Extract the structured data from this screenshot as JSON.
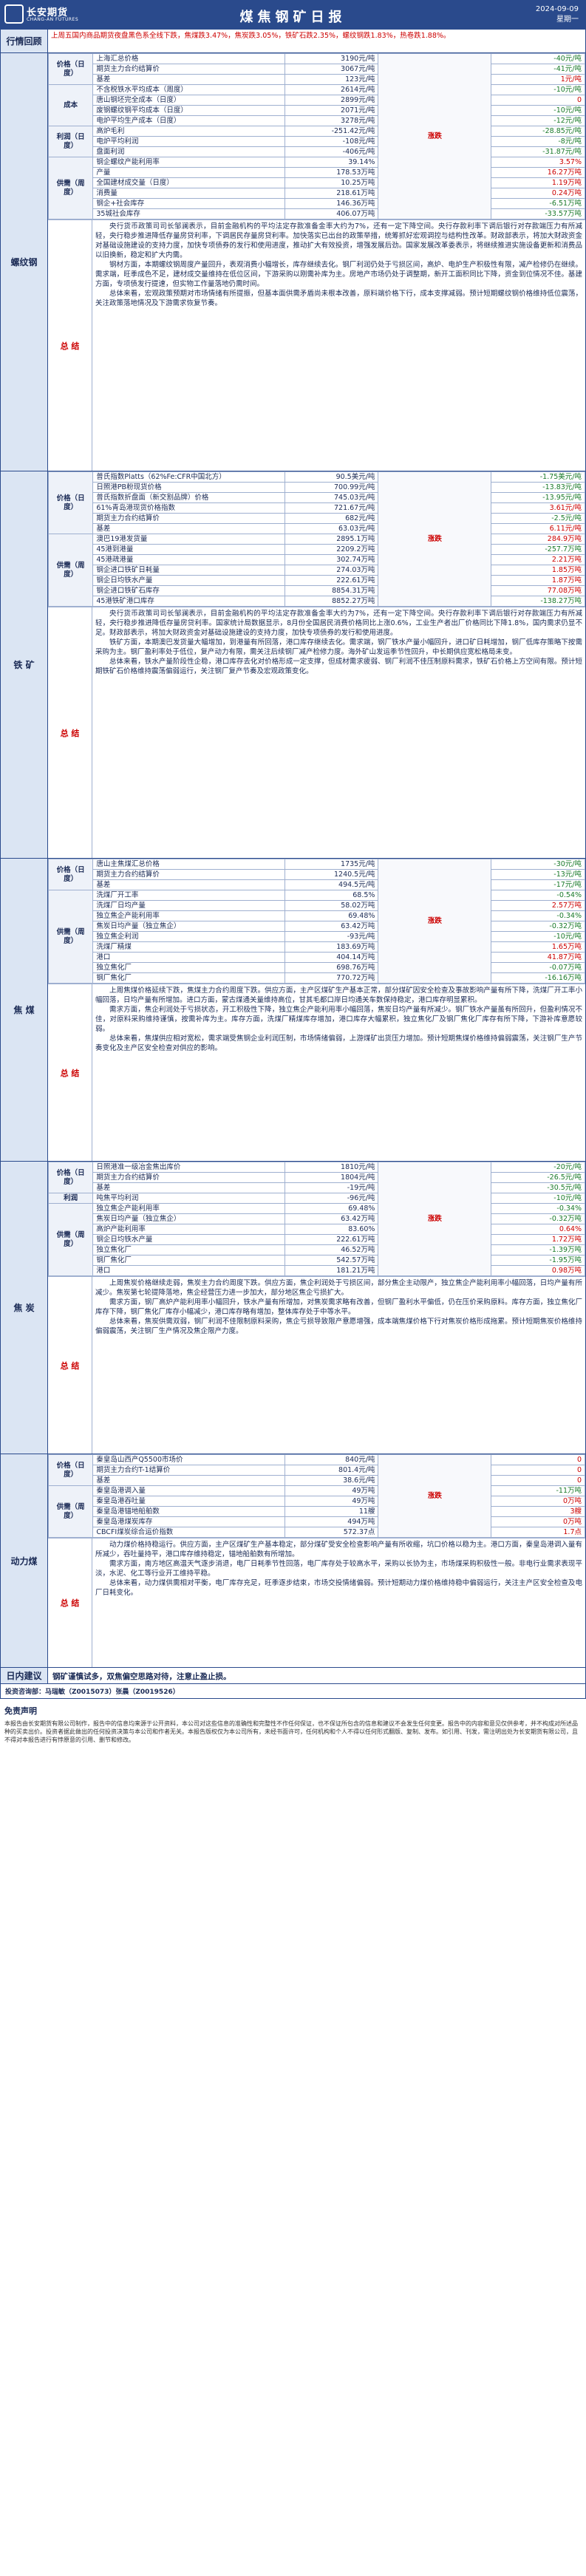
{
  "header": {
    "logo_cn": "长安期货",
    "logo_en": "CHANG-AN FUTURES",
    "title": "煤焦钢矿日报",
    "date": "2024-09-09",
    "weekday": "星期一"
  },
  "highlights": {
    "label": "行情回顾",
    "text": "上周五国内商品期货夜盘黑色系全线下跌，焦煤跌3.47%，焦炭跌3.05%，铁矿石跌2.35%，螺纹钢跌1.83%，热卷跌1.88%。"
  },
  "sections": [
    {
      "name": "螺纹钢",
      "groups": [
        {
          "cat": "价格（日度）",
          "rows": [
            {
              "item": "上海汇总价格",
              "value": "3190元/吨",
              "change": "-40元/吨",
              "dir": "neg"
            },
            {
              "item": "期货主力合约结算价",
              "value": "3067元/吨",
              "change": "-41元/吨",
              "dir": "neg"
            },
            {
              "item": "基差",
              "value": "123元/吨",
              "change": "1元/吨",
              "dir": "pos"
            }
          ]
        },
        {
          "cat": "成本",
          "rows": [
            {
              "item": "不含税铁水平均成本（周度）",
              "value": "2614元/吨",
              "change": "-10元/吨",
              "dir": "neg"
            },
            {
              "item": "唐山钢坯完全成本（日度）",
              "value": "2899元/吨",
              "change": "0",
              "dir": "pos"
            },
            {
              "item": "废钢螺纹钢平均成本（日度）",
              "value": "2071元/吨",
              "change": "-10元/吨",
              "dir": "neg"
            },
            {
              "item": "电炉平均生产成本（日度）",
              "value": "3278元/吨",
              "change": "-12元/吨",
              "dir": "neg"
            }
          ]
        },
        {
          "cat": "利润（日度）",
          "rows": [
            {
              "item": "高炉毛利",
              "value": "-251.42元/吨",
              "change": "-28.85元/吨",
              "dir": "neg"
            },
            {
              "item": "电炉平均利润",
              "value": "-108元/吨",
              "change": "-8元/吨",
              "dir": "neg"
            },
            {
              "item": "盘面利润",
              "value": "-406元/吨",
              "change": "-31.87元/吨",
              "dir": "neg"
            }
          ]
        },
        {
          "cat": "供需（周度）",
          "rows": [
            {
              "item": "钢企螺纹产能利用率",
              "value": "39.14%",
              "change": "3.57%",
              "dir": "pos"
            },
            {
              "item": "产量",
              "value": "178.53万吨",
              "change": "16.27万吨",
              "dir": "pos"
            },
            {
              "item": "全国建材成交量（日度）",
              "value": "10.25万吨",
              "change": "1.19万吨",
              "dir": "pos"
            },
            {
              "item": "消费量",
              "value": "218.61万吨",
              "change": "0.24万吨",
              "dir": "pos"
            },
            {
              "item": "钢企+社会库存",
              "value": "146.36万吨",
              "change": "-6.51万吨",
              "dir": "neg"
            },
            {
              "item": "35城社会库存",
              "value": "406.07万吨",
              "change": "-33.57万吨",
              "dir": "neg"
            }
          ]
        }
      ],
      "trend": "涨跌",
      "summary_label": "总 结",
      "summary": [
        "央行货币政策司司长邹澜表示，目前金融机构的平均法定存款准备金率大约为7%，还有一定下降空间。央行存款利率下调后银行对存款端压力有所减轻，央行稳步推进降低存量房贷利率，下调居民存量房贷利率。加快落实已出台的政策举措，统筹抓好宏观调控与结构性改革。财政部表示，将加大财政资金对基础设施建设的支持力度，加快专项债券的发行和使用进度，推动扩大有效投资，增强发展后劲。国家发展改革委表示，将继续推进实施设备更新和消费品以旧换新，稳定和扩大内需。",
        "钢材方面，本期螺纹钢周度产量回升，表观消费小幅增长，库存继续去化。钢厂利润仍处于亏损区间，高炉、电炉生产积极性有限，减产检修仍在继续。需求端，旺季成色不足，建材成交量维持在低位区间，下游采购以刚需补库为主。房地产市场仍处于调整期，新开工面积同比下降，资金到位情况不佳。基建方面，专项债发行提速，但实物工作量落地仍需时间。",
        "总体来看，宏观政策预期对市场情绪有所提振，但基本面供需矛盾尚未根本改善，原料端价格下行，成本支撑减弱。预计短期螺纹钢价格维持低位震荡，关注政策落地情况及下游需求恢复节奏。"
      ]
    },
    {
      "name": "铁 矿",
      "groups": [
        {
          "cat": "价格（日度）",
          "rows": [
            {
              "item": "普氏指数Platts（62%Fe:CFR中国北方）",
              "value": "90.5美元/吨",
              "change": "-1.75美元/吨",
              "dir": "neg"
            },
            {
              "item": "日照港PB粉现货价格",
              "value": "700.99元/吨",
              "change": "-13.83元/吨",
              "dir": "neg"
            },
            {
              "item": "普氏指数折盘面（新交割品牌）价格",
              "value": "745.03元/吨",
              "change": "-13.95元/吨",
              "dir": "neg"
            },
            {
              "item": "61%青岛港现货价格指数",
              "value": "721.67元/吨",
              "change": "3.61元/吨",
              "dir": "pos"
            },
            {
              "item": "期货主力合约结算价",
              "value": "682元/吨",
              "change": "-2.5元/吨",
              "dir": "neg"
            },
            {
              "item": "基差",
              "value": "63.03元/吨",
              "change": "6.11元/吨",
              "dir": "pos"
            }
          ]
        },
        {
          "cat": "供需（周度）",
          "rows": [
            {
              "item": "澳巴19港发货量",
              "value": "2895.1万吨",
              "change": "284.9万吨",
              "dir": "pos"
            },
            {
              "item": "45港到港量",
              "value": "2209.2万吨",
              "change": "-257.7万吨",
              "dir": "neg"
            },
            {
              "item": "45港疏港量",
              "value": "302.74万吨",
              "change": "2.21万吨",
              "dir": "pos"
            },
            {
              "item": "钢企进口铁矿日耗量",
              "value": "274.03万吨",
              "change": "1.85万吨",
              "dir": "pos"
            },
            {
              "item": "钢企日均铁水产量",
              "value": "222.61万吨",
              "change": "1.87万吨",
              "dir": "pos"
            },
            {
              "item": "钢企进口铁矿石库存",
              "value": "8854.31万吨",
              "change": "77.08万吨",
              "dir": "pos"
            },
            {
              "item": "45港铁矿港口库存",
              "value": "8852.27万吨",
              "change": "-138.27万吨",
              "dir": "neg"
            }
          ]
        }
      ],
      "trend": "涨跌",
      "summary_label": "总 结",
      "summary": [
        "央行货币政策司司长邹澜表示，目前金融机构的平均法定存款准备金率大约为7%，还有一定下降空间。央行存款利率下调后银行对存款端压力有所减轻，央行稳步推进降低存量房贷利率。国家统计局数据显示，8月份全国居民消费价格同比上涨0.6%，工业生产者出厂价格同比下降1.8%，国内需求仍显不足。财政部表示，将加大财政资金对基础设施建设的支持力度，加快专项债券的发行和使用进度。",
        "铁矿方面，本期澳巴发货量大幅增加，到港量有所回落，港口库存继续去化。需求端，钢厂铁水产量小幅回升，进口矿日耗增加，钢厂低库存策略下按需采购为主。钢厂盈利率处于低位，复产动力有限，需关注后续钢厂减产检修力度。海外矿山发运季节性回升，中长期供应宽松格局未变。",
        "总体来看，铁水产量阶段性企稳，港口库存去化对价格形成一定支撑，但成材需求疲弱、钢厂利润不佳压制原料需求，铁矿石价格上方空间有限。预计短期铁矿石价格维持震荡偏弱运行，关注钢厂复产节奏及宏观政策变化。"
      ]
    },
    {
      "name": "焦 煤",
      "groups": [
        {
          "cat": "价格（日度）",
          "rows": [
            {
              "item": "唐山主焦煤汇总价格",
              "value": "1735元/吨",
              "change": "-30元/吨",
              "dir": "neg"
            },
            {
              "item": "期货主力合约结算价",
              "value": "1240.5元/吨",
              "change": "-13元/吨",
              "dir": "neg"
            },
            {
              "item": "基差",
              "value": "494.5元/吨",
              "change": "-17元/吨",
              "dir": "neg"
            }
          ]
        },
        {
          "cat": "供需（周度）",
          "rows": [
            {
              "item": "洗煤厂开工率",
              "value": "68.5%",
              "change": "-0.54%",
              "dir": "neg"
            },
            {
              "item": "洗煤厂日均产量",
              "value": "58.02万吨",
              "change": "2.57万吨",
              "dir": "pos"
            },
            {
              "item": "独立焦企产能利用率",
              "value": "69.48%",
              "change": "-0.34%",
              "dir": "neg"
            },
            {
              "item": "焦炭日均产量（独立焦企）",
              "value": "63.42万吨",
              "change": "-0.32万吨",
              "dir": "neg"
            },
            {
              "item": "独立焦企利润",
              "value": "-93元/吨",
              "change": "-10元/吨",
              "dir": "neg"
            },
            {
              "item": "洗煤厂精煤",
              "value": "183.69万吨",
              "change": "1.65万吨",
              "dir": "pos"
            },
            {
              "item": "港口",
              "value": "404.14万吨",
              "change": "41.87万吨",
              "dir": "pos"
            },
            {
              "item": "独立焦化厂",
              "value": "698.76万吨",
              "change": "-0.07万吨",
              "dir": "neg"
            },
            {
              "item": "钢厂焦化厂",
              "value": "770.72万吨",
              "change": "-16.16万吨",
              "dir": "neg"
            }
          ]
        }
      ],
      "trend": "涨跌",
      "summary_label": "总 结",
      "summary": [
        "上周焦煤价格延续下跌，焦煤主力合约周度下跌。供应方面，主产区煤矿生产基本正常，部分煤矿因安全检查及事故影响产量有所下降，洗煤厂开工率小幅回落，日均产量有所增加。进口方面，蒙古煤通关量维持高位，甘其毛都口岸日均通关车数保持稳定，港口库存明显累积。",
        "需求方面，焦企利润处于亏损状态，开工积极性下降，独立焦企产能利用率小幅回落，焦炭日均产量有所减少。钢厂铁水产量虽有所回升，但盈利情况不佳，对原料采购维持谨慎，按需补库为主。库存方面，洗煤厂精煤库存增加，港口库存大幅累积，独立焦化厂及钢厂焦化厂库存有所下降，下游补库意愿较弱。",
        "总体来看，焦煤供应相对宽松，需求端受焦钢企业利润压制，市场情绪偏弱，上游煤矿出货压力增加。预计短期焦煤价格维持偏弱震荡，关注钢厂生产节奏变化及主产区安全检查对供应的影响。"
      ]
    },
    {
      "name": "焦 炭",
      "groups": [
        {
          "cat": "价格（日度）",
          "rows": [
            {
              "item": "日照港准一级冶金焦出库价",
              "value": "1810元/吨",
              "change": "-20元/吨",
              "dir": "neg"
            },
            {
              "item": "期货主力合约结算价",
              "value": "1804元/吨",
              "change": "-26.5元/吨",
              "dir": "neg"
            },
            {
              "item": "基差",
              "value": "-19元/吨",
              "change": "-30.5元/吨",
              "dir": "neg"
            }
          ]
        },
        {
          "cat": "利润",
          "rows": [
            {
              "item": "吨焦平均利润",
              "value": "-96元/吨",
              "change": "-10元/吨",
              "dir": "neg"
            }
          ]
        },
        {
          "cat": "供需（周度）",
          "rows": [
            {
              "item": "独立焦企产能利用率",
              "value": "69.48%",
              "change": "-0.34%",
              "dir": "neg"
            },
            {
              "item": "焦炭日均产量（独立焦企）",
              "value": "63.42万吨",
              "change": "-0.32万吨",
              "dir": "neg"
            },
            {
              "item": "高炉产能利用率",
              "value": "83.60%",
              "change": "0.64%",
              "dir": "pos"
            },
            {
              "item": "钢企日均铁水产量",
              "value": "222.61万吨",
              "change": "1.72万吨",
              "dir": "pos"
            },
            {
              "item": "独立焦化厂",
              "value": "46.52万吨",
              "change": "-1.39万吨",
              "dir": "neg"
            },
            {
              "item": "钢厂焦化厂",
              "value": "542.57万吨",
              "change": "-1.95万吨",
              "dir": "neg"
            },
            {
              "item": "港口",
              "value": "181.21万吨",
              "change": "0.98万吨",
              "dir": "pos"
            }
          ]
        }
      ],
      "trend": "涨跌",
      "summary_label": "总 结",
      "summary": [
        "上周焦炭价格继续走弱，焦炭主力合约周度下跌。供应方面，焦企利润处于亏损区间，部分焦企主动限产，独立焦企产能利用率小幅回落，日均产量有所减少。焦炭第七轮提降落地，焦企经营压力进一步加大，部分地区焦企亏损扩大。",
        "需求方面，钢厂高炉产能利用率小幅回升，铁水产量有所增加，对焦炭需求略有改善，但钢厂盈利水平偏低，仍在压价采购原料。库存方面，独立焦化厂库存下降，钢厂焦化厂库存小幅减少，港口库存略有增加，整体库存处于中等水平。",
        "总体来看，焦炭供需双弱，钢厂利润不佳限制原料采购，焦企亏损导致限产意愿增强，成本端焦煤价格下行对焦炭价格形成拖累。预计短期焦炭价格维持偏弱震荡，关注钢厂生产情况及焦企限产力度。"
      ]
    },
    {
      "name": "动力煤",
      "groups": [
        {
          "cat": "价格（日度）",
          "rows": [
            {
              "item": "秦皇岛山西产Q5500市场价",
              "value": "840元/吨",
              "change": "0",
              "dir": "pos"
            },
            {
              "item": "期货主力合约T-1结算价",
              "value": "801.4元/吨",
              "change": "0",
              "dir": "pos"
            },
            {
              "item": "基差",
              "value": "38.6元/吨",
              "change": "0",
              "dir": "pos"
            }
          ]
        },
        {
          "cat": "供需（周度）",
          "rows": [
            {
              "item": "秦皇岛港调入量",
              "value": "49万吨",
              "change": "-11万吨",
              "dir": "neg"
            },
            {
              "item": "秦皇岛港吞吐量",
              "value": "49万吨",
              "change": "0万吨",
              "dir": "pos"
            },
            {
              "item": "秦皇岛港锚地船舶数",
              "value": "11艘",
              "change": "3艘",
              "dir": "pos"
            },
            {
              "item": "秦皇岛港煤炭库存",
              "value": "494万吨",
              "change": "0万吨",
              "dir": "pos"
            },
            {
              "item": "CBCFI煤炭综合运价指数",
              "value": "572.37点",
              "change": "1.7点",
              "dir": "pos"
            }
          ]
        }
      ],
      "trend": "涨跌",
      "summary_label": "总 结",
      "summary": [
        "动力煤价格持稳运行。供应方面，主产区煤矿生产基本稳定，部分煤矿受安全检查影响产量有所收缩，坑口价格以稳为主。港口方面，秦皇岛港调入量有所减少，吞吐量持平，港口库存维持稳定，锚地船舶数有所增加。",
        "需求方面，南方地区高温天气逐步消退，电厂日耗季节性回落，电厂库存处于较高水平，采购以长协为主，市场煤采购积极性一般。非电行业需求表现平淡，水泥、化工等行业开工维持平稳。",
        "总体来看，动力煤供需相对平衡，电厂库存充足，旺季逐步结束，市场交投情绪偏弱。预计短期动力煤价格维持稳中偏弱运行，关注主产区安全检查及电厂日耗变化。"
      ]
    }
  ],
  "advice": {
    "label": "日内建议",
    "text": "钢矿谨慎试多，双焦偏空思路对待，注意止盈止损。"
  },
  "authors": "投资咨询部：马瑞敏（Z0015073）张晨（Z0019526）",
  "disclaimer": {
    "title": "免责声明",
    "text": "本报告由长安期货有限公司制作，报告中的信息均来源于公开资料，本公司对这些信息的准确性和完整性不作任何保证，也不保证所包含的信息和建议不会发生任何变更。报告中的内容和意见仅供参考，并不构成对所述品种的买卖出价。投资者据此做出的任何投资决策与本公司和作者无关。本报告版权仅为本公司所有，未经书面许可，任何机构和个人不得以任何形式翻版、复制、发布。如引用、刊发，需注明出处为长安期货有限公司，且不得对本报告进行有悖原意的引用、删节和修改。"
  }
}
